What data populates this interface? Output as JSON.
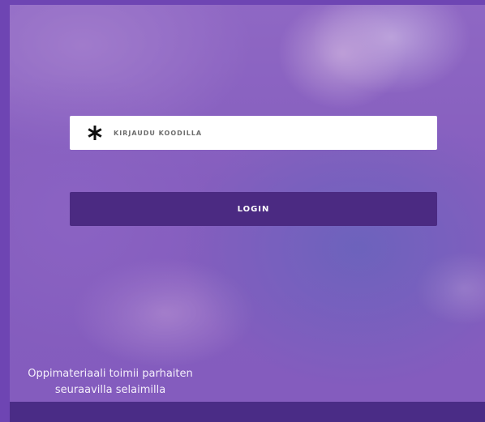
{
  "login": {
    "code_placeholder": "KIRJAUDU KOODILLA",
    "code_value": "",
    "login_label": "LOGIN"
  },
  "info": {
    "line1": "Oppimateriaali toimii parhaiten",
    "line2": "seuraavilla selaimilla"
  },
  "icons": {
    "code_field_icon": "asterisk-icon"
  },
  "colors": {
    "frame": "#6e45b3",
    "button": "#4b2a82",
    "bottom_strip": "#4a2c86",
    "input_bg": "#ffffff"
  }
}
